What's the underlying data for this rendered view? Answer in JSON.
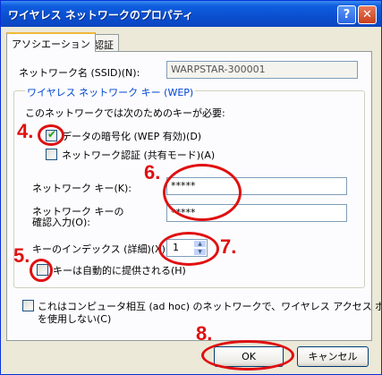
{
  "window": {
    "title": "ワイヤレス ネットワークのプロパティ",
    "help_label": "?",
    "close_label": "✕"
  },
  "tabs": [
    {
      "label": "アソシエーション",
      "active": true
    },
    {
      "label": "認証",
      "active": false
    }
  ],
  "ssid": {
    "label": "ネットワーク名 (SSID)(N):",
    "value": "WARPSTAR-300001"
  },
  "wep_group": {
    "title": "ワイヤレス ネットワーク キー (WEP)",
    "note": "このネットワークでは次のためのキーが必要:",
    "encrypt_label": "データの暗号化 (WEP 有効)(D)",
    "encrypt_checked": true,
    "shared_auth_label": "ネットワーク認証 (共有モード)(A)",
    "shared_auth_checked": false,
    "key_label": "ネットワーク キー(K):",
    "key_value": "*****",
    "confirm_label_1": "ネットワーク キーの",
    "confirm_label_2": "確認入力(O):",
    "confirm_value": "*****",
    "index_label": "キーのインデックス (詳細)(X):",
    "index_value": "1",
    "auto_key_label": "キーは自動的に提供される(H)",
    "auto_key_checked": false
  },
  "adhoc": {
    "label_line1": "これはコンピュータ相互 (ad hoc) のネットワークで、ワイヤレス アクセス ポイント",
    "label_line2": "を使用しない(C)",
    "checked": false
  },
  "buttons": {
    "ok": "OK",
    "cancel": "キャンセル"
  },
  "annotations": {
    "n4": "4.",
    "n5": "5.",
    "n6": "6.",
    "n7": "7.",
    "n8": "8."
  },
  "colors": {
    "titlebar": "#0a4fd0",
    "annotation": "#e01010",
    "group_title": "#0046d5"
  }
}
